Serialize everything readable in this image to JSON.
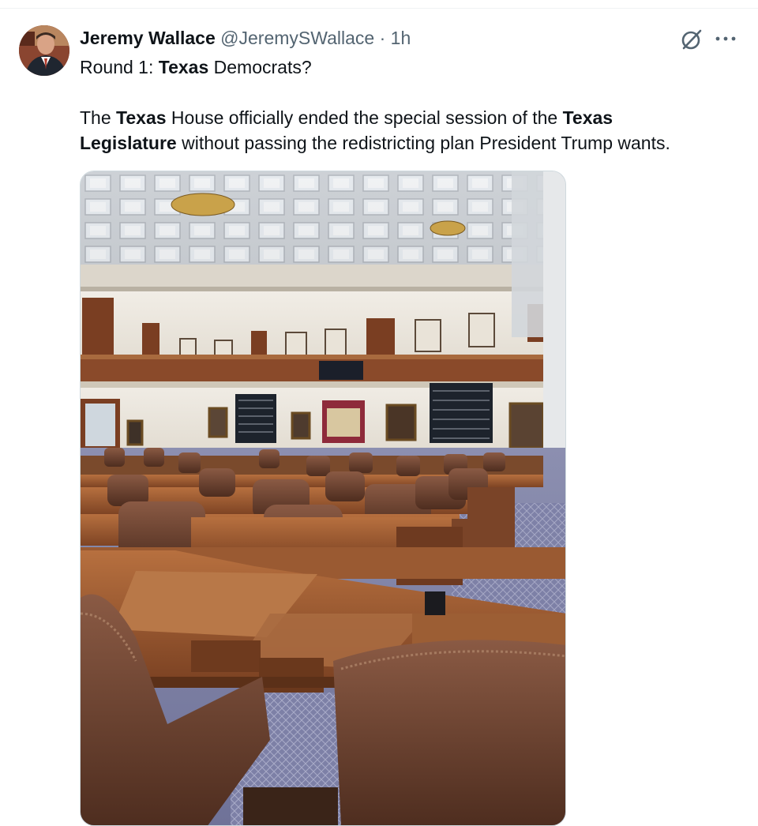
{
  "post": {
    "author_name": "Jeremy Wallace",
    "author_handle": "@JeremySWallace",
    "separator": "·",
    "time": "1h",
    "line1": {
      "a": "Round 1: ",
      "b": "Texas",
      "c": " Democrats?"
    },
    "body": {
      "a": "The ",
      "b": "Texas",
      "c": " House officially ended the special session of the ",
      "d": "Texas",
      "e": " ",
      "f": "Legislature",
      "g": " without passing the redistricting plan President Trump wants."
    }
  },
  "icons": {
    "grok": "grok-icon",
    "more": "more-dots-icon"
  },
  "colors": {
    "text": "#0f1419",
    "secondary": "#536471",
    "border": "#cfd9de"
  }
}
